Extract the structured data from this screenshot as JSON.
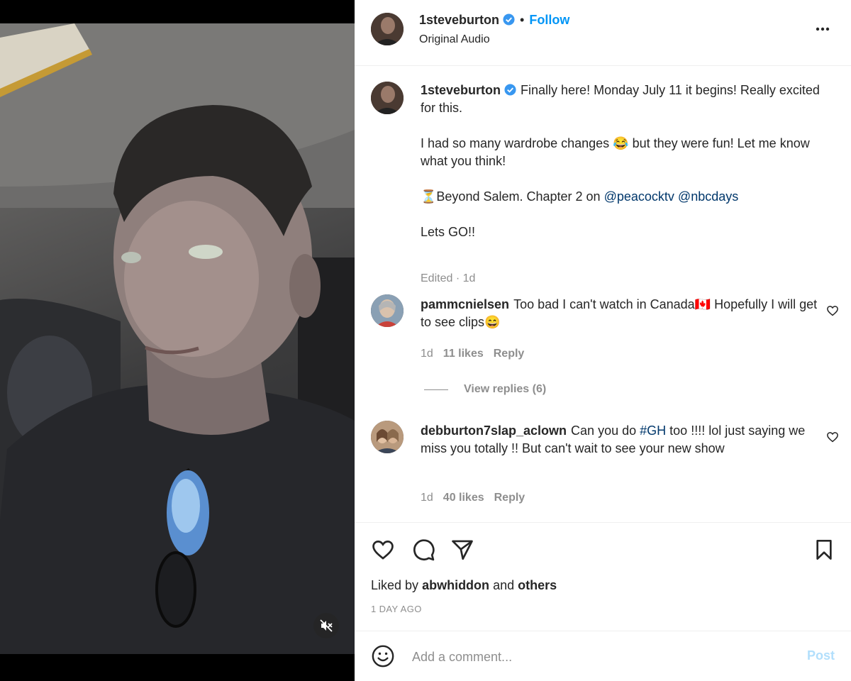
{
  "post": {
    "username": "1steveburton",
    "follow_label": "Follow",
    "audio_label": "Original Audio",
    "caption_intro": "Finally here! Monday July 11 it begins! Really excited for this.",
    "caption_line2": "I had so many wardrobe changes 😂 but they were fun! Let me know what you think!",
    "caption_line3_prefix": "⏳Beyond Salem. Chapter 2 on",
    "mention1": "@peacocktv",
    "mention2": "@nbcdays",
    "caption_line4": "Lets GO!!",
    "edited_time": "Edited · 1d"
  },
  "comments": [
    {
      "username": "pammcnielsen",
      "text": "Too bad I can't watch in Canada🇨🇦 Hopefully I will get to see clips😄",
      "time": "1d",
      "likes": "11 likes",
      "reply": "Reply",
      "view_replies": "View replies (6)"
    },
    {
      "username": "debburton7slap_aclown",
      "text_before": "Can you do",
      "hashtag": "#GH",
      "text_after": "too !!!! lol just saying we miss you totally !! But can't wait to see your new show",
      "time": "1d",
      "likes": "40 likes",
      "reply": "Reply"
    }
  ],
  "actions": {
    "liked_by_prefix": "Liked by",
    "liked_by_user": "abwhiddon",
    "liked_and": "and",
    "liked_others": "others",
    "timestamp": "1 DAY AGO"
  },
  "add_comment": {
    "placeholder": "Add a comment...",
    "post_label": "Post"
  },
  "icons": {
    "verified": "verified-badge-icon",
    "more": "more-options-icon",
    "mute": "muted-speaker-icon",
    "like": "heart-icon",
    "comment": "comment-bubble-icon",
    "share": "paper-plane-icon",
    "save": "bookmark-icon",
    "emoji": "smiley-icon"
  },
  "colors": {
    "accent": "#0095f6",
    "link": "#00376b",
    "muted_text": "#8e8e8e",
    "verified": "#3897f0"
  }
}
